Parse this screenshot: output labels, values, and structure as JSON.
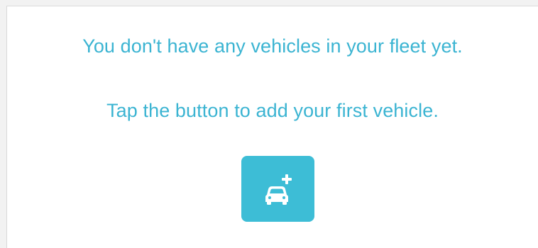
{
  "empty_state": {
    "message_primary": "You don't have any vehicles in your fleet yet.",
    "message_secondary": "Tap the button to add your first vehicle."
  },
  "add_button": {
    "icon": "car-plus-icon"
  },
  "colors": {
    "accent": "#3dbdd6",
    "text_accent": "#3bb4d2",
    "icon": "#ffffff",
    "background": "#ffffff"
  }
}
